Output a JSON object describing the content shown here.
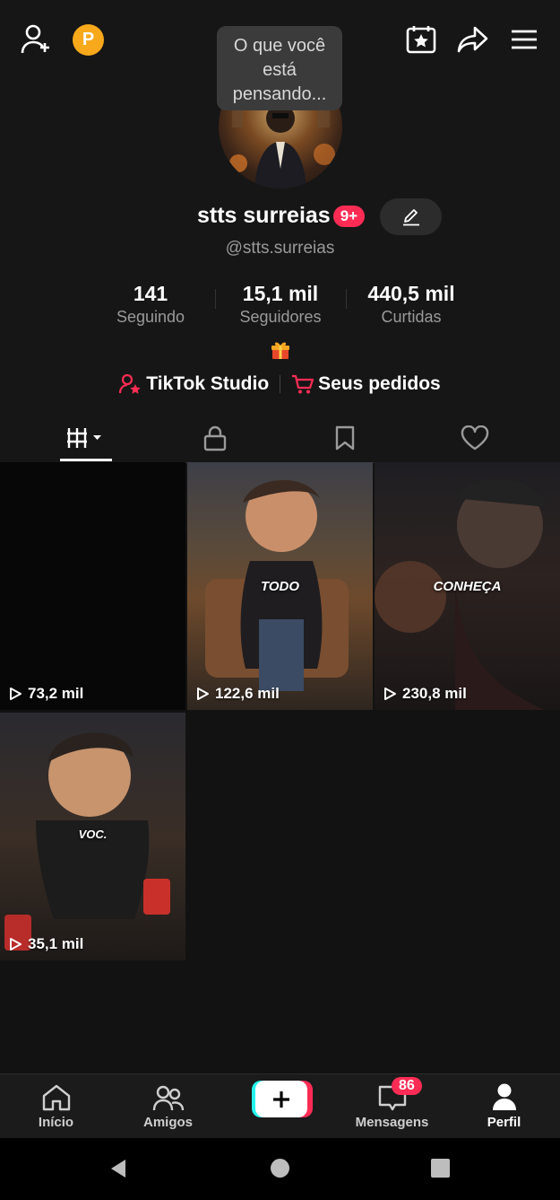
{
  "header": {
    "thought_bubble": "O que você está pensando...",
    "coin_label": "P"
  },
  "profile": {
    "display_name": "stts surreias",
    "notification_badge": "9+",
    "username": "@stts.surreias"
  },
  "stats": [
    {
      "value": "141",
      "label": "Seguindo"
    },
    {
      "value": "15,1 mil",
      "label": "Seguidores"
    },
    {
      "value": "440,5 mil",
      "label": "Curtidas"
    }
  ],
  "links": {
    "studio": "TikTok Studio",
    "orders": "Seus pedidos"
  },
  "videos": [
    {
      "views": "73,2 mil",
      "overlay": ""
    },
    {
      "views": "122,6 mil",
      "overlay": "TODO"
    },
    {
      "views": "230,8 mil",
      "overlay": "CONHEÇA"
    },
    {
      "views": "35,1 mil",
      "overlay": "VOC."
    }
  ],
  "nav": {
    "home": "Início",
    "friends": "Amigos",
    "messages": "Mensagens",
    "messages_badge": "86",
    "profile": "Perfil"
  },
  "colors": {
    "accent": "#fe2c55",
    "coin": "#f7a81b",
    "background": "#121212"
  }
}
